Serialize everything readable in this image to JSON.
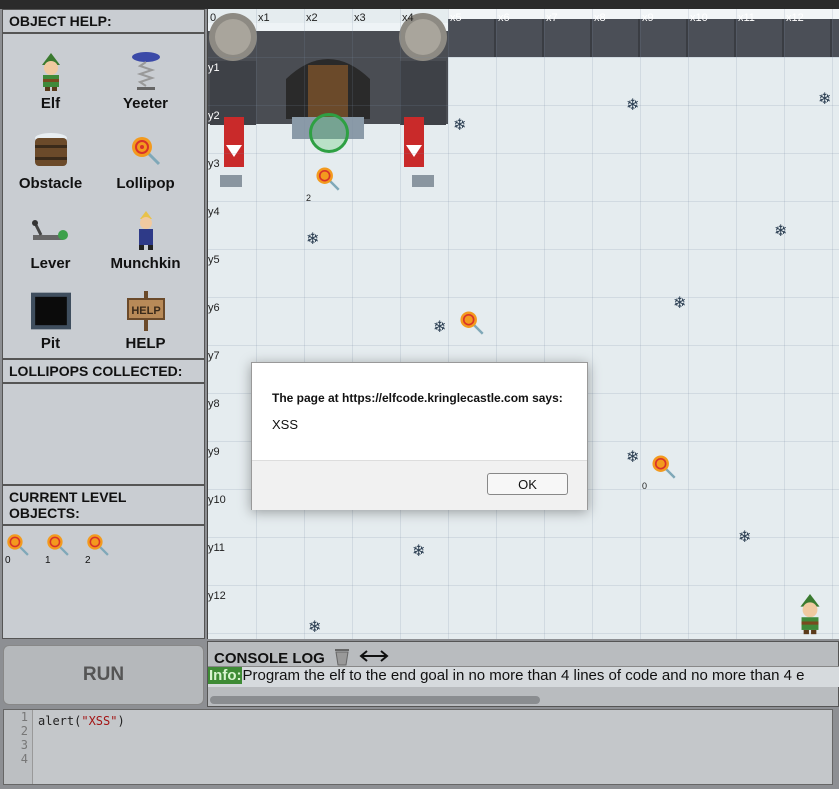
{
  "left_panel": {
    "object_help_title": "OBJECT HELP:",
    "objects": [
      {
        "label": "Elf",
        "icon": "elf-icon"
      },
      {
        "label": "Yeeter",
        "icon": "yeeter-icon"
      },
      {
        "label": "Obstacle",
        "icon": "obstacle-icon"
      },
      {
        "label": "Lollipop",
        "icon": "lollipop-icon"
      },
      {
        "label": "Lever",
        "icon": "lever-icon"
      },
      {
        "label": "Munchkin",
        "icon": "munchkin-icon"
      },
      {
        "label": "Pit",
        "icon": "pit-icon"
      },
      {
        "label": "HELP",
        "icon": "help-sign-icon"
      }
    ],
    "lollipops_collected_title": "LOLLIPOPS COLLECTED:",
    "current_level_title": "CURRENT LEVEL OBJECTS:",
    "level_objects": [
      {
        "id": "0",
        "icon": "lollipop-icon"
      },
      {
        "id": "1",
        "icon": "lollipop-icon"
      },
      {
        "id": "2",
        "icon": "lollipop-icon"
      }
    ],
    "help_sign_text": "HELP"
  },
  "game": {
    "x_labels": [
      "0",
      "x1",
      "x2",
      "x3",
      "x4",
      "x5",
      "x6",
      "x7",
      "x8",
      "x9",
      "x10",
      "x11",
      "x12"
    ],
    "y_labels": [
      "y1",
      "y2",
      "y3",
      "y4",
      "y5",
      "y6",
      "y7",
      "y8",
      "y9",
      "y10",
      "y11",
      "y12"
    ],
    "lollipop_labels": {
      "a": "2",
      "b": "0"
    }
  },
  "run_button": "RUN",
  "console": {
    "title": "CONSOLE LOG",
    "info_tag": "Info:",
    "message": "Program the elf to the end goal in no more than 4 lines of code and no more than 4 e"
  },
  "editor": {
    "line_numbers": [
      "1",
      "2",
      "3",
      "4"
    ],
    "code_prefix": "alert(",
    "code_string": "\"XSS\"",
    "code_suffix": ")"
  },
  "dialog": {
    "message": "The page at https://elfcode.kringlecastle.com says:",
    "text": "XSS",
    "ok_label": "OK"
  },
  "colors": {
    "info_tag_bg": "#3e8b35",
    "goal_ring": "#2ea043",
    "ice": "#e5ecef"
  }
}
